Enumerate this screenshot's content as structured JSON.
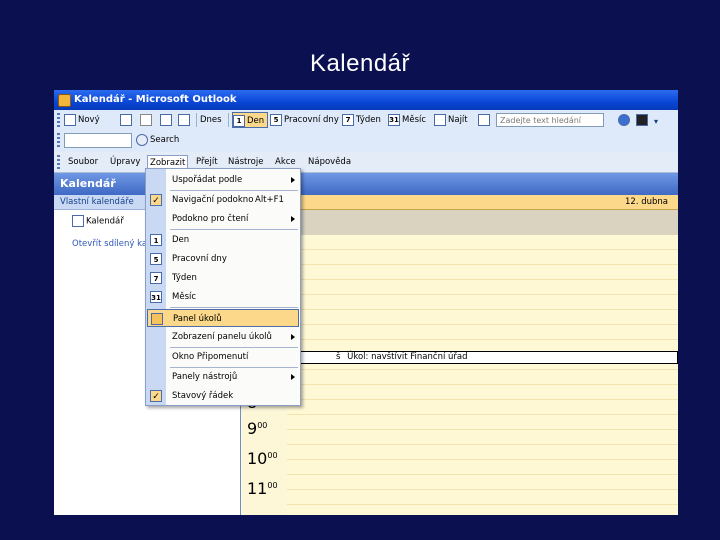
{
  "slide": {
    "title": "Kalendář"
  },
  "window": {
    "title": "Kalendář - Microsoft Outlook"
  },
  "toolbar1": {
    "new_label": "Nový",
    "today_label": "Dnes",
    "day_label": "Den",
    "workweek_label": "Pracovní dny",
    "week_label": "Týden",
    "month_label": "Měsíc",
    "find_label": "Najít",
    "find_placeholder": "Zadejte text hledání",
    "day_num": "1",
    "workweek_num": "5",
    "week_num": "7",
    "month_num": "31"
  },
  "toolbar2": {
    "search_label": "Search"
  },
  "menubar": {
    "items": [
      "Soubor",
      "Úpravy",
      "Zobrazit",
      "Přejít",
      "Nástroje",
      "Akce",
      "Nápověda"
    ]
  },
  "nav": {
    "header": "Kalendář",
    "section": "Vlastní kalendáře",
    "calendar_item": "Kalendář",
    "link": "Otevřít sdílený kal"
  },
  "calendar": {
    "date_header": "12. dubna",
    "task_text": "Úkol: navštívit Finanční úřad",
    "task_prefix": "š",
    "hours": [
      {
        "h": "8",
        "m": ""
      },
      {
        "h": "9",
        "m": "00"
      },
      {
        "h": "10",
        "m": "00"
      },
      {
        "h": "11",
        "m": "00"
      }
    ]
  },
  "view_menu": {
    "items": [
      {
        "label": "Uspořádat podle",
        "submenu": true
      },
      {
        "label": "Navigační podokno",
        "shortcut": "Alt+F1",
        "checked": true
      },
      {
        "label": "Podokno pro čtení",
        "submenu": true
      },
      {
        "label": "Den",
        "icon": "1"
      },
      {
        "label": "Pracovní dny",
        "icon": "5"
      },
      {
        "label": "Týden",
        "icon": "7"
      },
      {
        "label": "Měsíc",
        "icon": "31"
      },
      {
        "label": "Panel úkolů",
        "highlighted": true
      },
      {
        "label": "Zobrazení panelu úkolů",
        "submenu": true
      },
      {
        "label": "Okno Připomenutí"
      },
      {
        "label": "Panely nástrojů",
        "submenu": true
      },
      {
        "label": "Stavový řádek",
        "checked": true
      }
    ]
  },
  "colors": {
    "slide_bg": "#0b1150",
    "titlebar": "#0a46d6",
    "highlight": "#fbd88a",
    "calendar_bg": "#fdf7d8"
  }
}
